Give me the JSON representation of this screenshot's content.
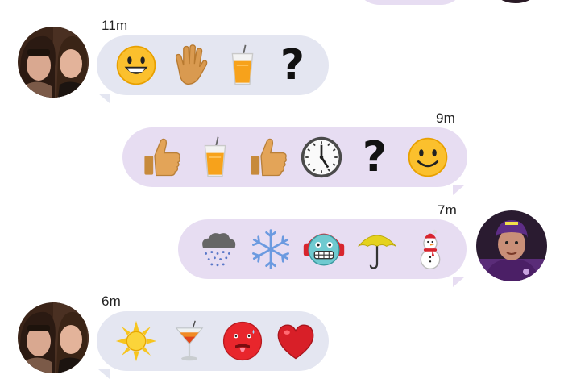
{
  "messages": [
    {
      "time": "11m"
    },
    {
      "time": "9m"
    },
    {
      "time": "7m"
    },
    {
      "time": "6m"
    }
  ],
  "question_mark": "?",
  "colors": {
    "incoming_bubble": "#e4e6f1",
    "outgoing_bubble": "#e7ddf2"
  },
  "emoji_names": [
    [
      "grinning-face-icon",
      "raised-hand-icon",
      "juice-cup-icon",
      "question-mark-icon"
    ],
    [
      "thumbs-up-icon",
      "juice-cup-icon",
      "thumbs-up-icon",
      "clock-icon",
      "question-mark-icon",
      "smiling-face-icon"
    ],
    [
      "rain-cloud-icon",
      "snowflake-icon",
      "cold-face-icon",
      "umbrella-icon",
      "snowman-icon"
    ],
    [
      "sun-icon",
      "cocktail-icon",
      "sick-face-icon",
      "red-heart-icon"
    ]
  ]
}
